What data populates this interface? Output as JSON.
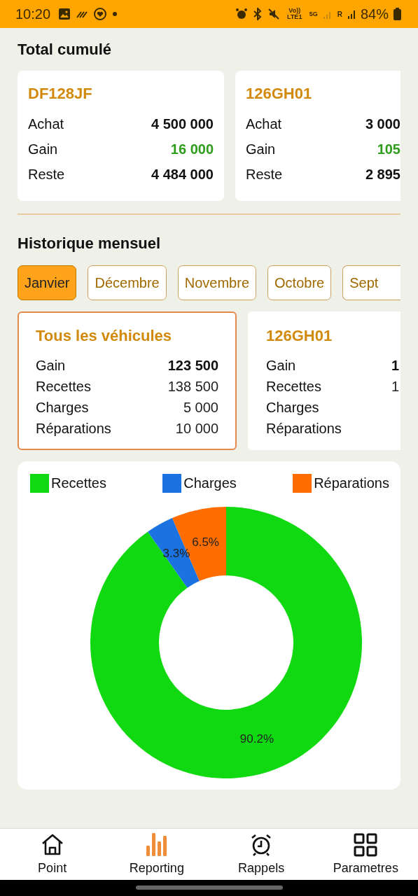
{
  "status_bar": {
    "time": "10:20",
    "network": "Vo)) LTE1",
    "generation": "5G",
    "roaming": "R",
    "battery": "84%"
  },
  "total": {
    "title": "Total cumulé",
    "cards": [
      {
        "plate": "DF128JF",
        "rows": [
          {
            "label": "Achat",
            "value": "4 500 000",
            "kind": "plain"
          },
          {
            "label": "Gain",
            "value": "16 000",
            "kind": "gain"
          },
          {
            "label": "Reste",
            "value": "4 484 000",
            "kind": "plain"
          }
        ]
      },
      {
        "plate": "126GH01",
        "rows": [
          {
            "label": "Achat",
            "value": "3 000",
            "kind": "plain"
          },
          {
            "label": "Gain",
            "value": "105",
            "kind": "gain"
          },
          {
            "label": "Reste",
            "value": "2 895",
            "kind": "plain"
          }
        ]
      }
    ]
  },
  "history": {
    "title": "Historique mensuel",
    "months": [
      {
        "label": "Janvier",
        "selected": true
      },
      {
        "label": "Décembre",
        "selected": false
      },
      {
        "label": "Novembre",
        "selected": false
      },
      {
        "label": "Octobre",
        "selected": false
      },
      {
        "label": "Sept",
        "selected": false
      }
    ],
    "cards": [
      {
        "title": "Tous les véhicules",
        "selected": true,
        "rows": [
          {
            "label": "Gain",
            "value": "123 500",
            "kind": "gain"
          },
          {
            "label": "Recettes",
            "value": "138 500",
            "kind": "plain"
          },
          {
            "label": "Charges",
            "value": "5 000",
            "kind": "plain"
          },
          {
            "label": "Réparations",
            "value": "10 000",
            "kind": "plain"
          }
        ]
      },
      {
        "title": "126GH01",
        "selected": false,
        "rows": [
          {
            "label": "Gain",
            "value": "1",
            "kind": "gain"
          },
          {
            "label": "Recettes",
            "value": "1",
            "kind": "plain"
          },
          {
            "label": "Charges"
          },
          {
            "label": "Réparations"
          }
        ]
      }
    ],
    "legend": [
      {
        "color": "#11d911"
      },
      {
        "color": "#1a73e0"
      },
      {
        "color": "#ff6d00"
      }
    ],
    "chart_data": {
      "type": "donut",
      "categories": [
        "Recettes",
        "Charges",
        "Réparations"
      ],
      "values": [
        90.2,
        3.3,
        6.5
      ],
      "value_labels": [
        "90.2%",
        "3.3%",
        "6.5%"
      ]
    }
  },
  "nav": [
    {
      "label": "Point",
      "selected": false
    },
    {
      "label": "Reporting",
      "selected": true
    },
    {
      "label": "Rappels",
      "selected": false
    },
    {
      "label": "Parametres",
      "selected": false
    }
  ]
}
